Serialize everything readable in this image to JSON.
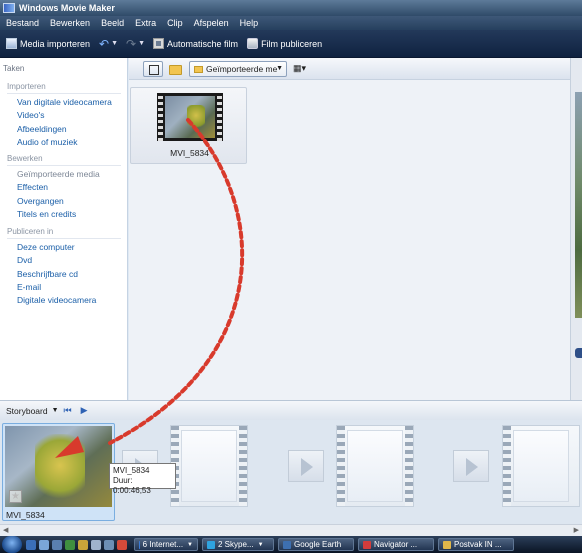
{
  "window": {
    "title": "Windows Movie Maker"
  },
  "menu": [
    "Bestand",
    "Bewerken",
    "Beeld",
    "Extra",
    "Clip",
    "Afspelen",
    "Help"
  ],
  "toolbar": {
    "import_label": "Media importeren",
    "auto_film_label": "Automatische film",
    "publish_label": "Film publiceren"
  },
  "taskpane": {
    "title": "Taken",
    "sections": [
      {
        "header": "Importeren",
        "links": [
          "Van digitale videocamera",
          "Video's",
          "Afbeeldingen",
          "Audio of muziek"
        ]
      },
      {
        "header": "Bewerken",
        "links": [
          "Geïmporteerde media",
          "Effecten",
          "Overgangen",
          "Titels en credits"
        ]
      },
      {
        "header": "Publiceren in",
        "links": [
          "Deze computer",
          "Dvd",
          "Beschrijfbare cd",
          "E-mail",
          "Digitale videocamera"
        ]
      }
    ]
  },
  "collection": {
    "selected": "Geïmporteerde me",
    "clip_name": "MVI_5834"
  },
  "storyboard": {
    "label": "Storyboard",
    "clip_name": "MVI_5834"
  },
  "tooltip": {
    "name": "MVI_5834",
    "duration": "Duur:  0:00:46,53"
  },
  "taskbar": {
    "tasks": [
      "6 Internet...",
      "2 Skype...",
      "Google Earth",
      "Navigator ...",
      "Postvak IN ..."
    ]
  },
  "colors": {
    "link": "#1b5fa8",
    "arrow": "#d83a2c",
    "toolbar_bg": "#1a2e4d"
  }
}
